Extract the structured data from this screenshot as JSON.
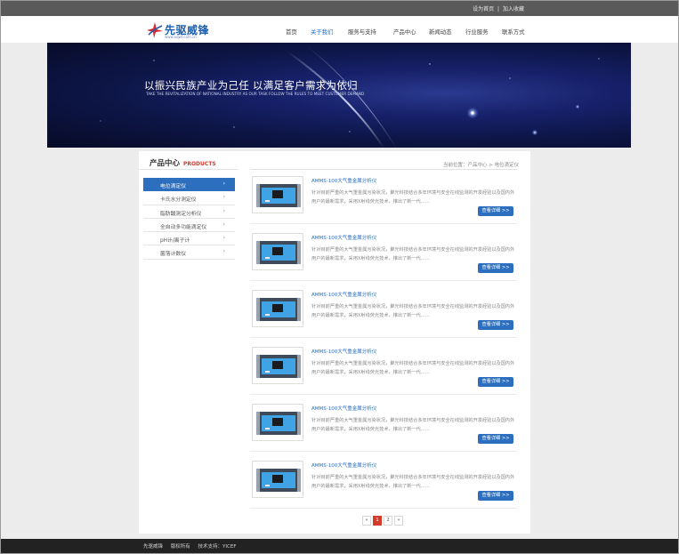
{
  "topbar": {
    "set_home": "设为首页",
    "separator": "|",
    "add_favorite": "加入收藏"
  },
  "logo": {
    "name": "先驱威锋",
    "url": "www.xqwf.com.cn"
  },
  "nav": [
    {
      "label": "首页",
      "active": false
    },
    {
      "label": "关于我们",
      "active": true
    },
    {
      "label": "服务与支持",
      "active": false
    },
    {
      "label": "产品中心",
      "active": false
    },
    {
      "label": "新闻动态",
      "active": false
    },
    {
      "label": "行业服务",
      "active": false
    },
    {
      "label": "联系方式",
      "active": false
    }
  ],
  "banner": {
    "title": "以振兴民族产业为己任   以满足客户需求为依归",
    "subtitle": "TAKE THE REVITALIZATION OF NATIONAL INDUSTRY AS OUR TASK    FOLLOW THE RULES TO MEET CUSTOMER DEMAND"
  },
  "sidebar": {
    "title_cn": "产品中心",
    "title_en": "PRODUCTS",
    "items": [
      {
        "label": "电位滴定仪",
        "active": true
      },
      {
        "label": "卡氏水分测定仪",
        "active": false
      },
      {
        "label": "脂肪酸测定分析仪",
        "active": false
      },
      {
        "label": "全自动多功能滴定仪",
        "active": false
      },
      {
        "label": "pH计/离子计",
        "active": false
      },
      {
        "label": "菌落计数仪",
        "active": false
      }
    ],
    "arrow": "›"
  },
  "breadcrumb": "当前位置：产品中心 > 电位滴定仪",
  "products": [
    {
      "title": "AMMS-100大气重金属分析仪",
      "desc": "针对目前严重的大气重金属污染状况，聚光科技结合多年环境与安全在线监测的开发经验以及国内外用户的最新需求，采用X射线荧光技术，推出了新一代......",
      "button": "查看详细 >>"
    },
    {
      "title": "AMMS-100大气重金属分析仪",
      "desc": "针对目前严重的大气重金属污染状况，聚光科技结合多年环境与安全在线监测的开发经验以及国内外用户的最新需求，采用X射线荧光技术，推出了新一代......",
      "button": "查看详细 >>"
    },
    {
      "title": "AMMS-100大气重金属分析仪",
      "desc": "针对目前严重的大气重金属污染状况，聚光科技结合多年环境与安全在线监测的开发经验以及国内外用户的最新需求，采用X射线荧光技术，推出了新一代......",
      "button": "查看详细 >>"
    },
    {
      "title": "AMMS-100大气重金属分析仪",
      "desc": "针对目前严重的大气重金属污染状况，聚光科技结合多年环境与安全在线监测的开发经验以及国内外用户的最新需求，采用X射线荧光技术，推出了新一代......",
      "button": "查看详细 >>"
    },
    {
      "title": "AMMS-100大气重金属分析仪",
      "desc": "针对目前严重的大气重金属污染状况，聚光科技结合多年环境与安全在线监测的开发经验以及国内外用户的最新需求，采用X射线荧光技术，推出了新一代......",
      "button": "查看详细 >>"
    },
    {
      "title": "AMMS-100大气重金属分析仪",
      "desc": "针对目前严重的大气重金属污染状况，聚光科技结合多年环境与安全在线监测的开发经验以及国内外用户的最新需求，采用X射线荧光技术，推出了新一代......",
      "button": "查看详细 >>"
    }
  ],
  "pagination": {
    "prev": "«",
    "pages": [
      "1",
      "2"
    ],
    "current": "1",
    "next": "»"
  },
  "footer": {
    "company": "先驱威锋",
    "rights": "版权所有",
    "support": "技术支持：YICEF"
  },
  "colors": {
    "accent": "#2c6fbf",
    "red": "#d43b2b",
    "banner_dark": "#0d1545"
  }
}
